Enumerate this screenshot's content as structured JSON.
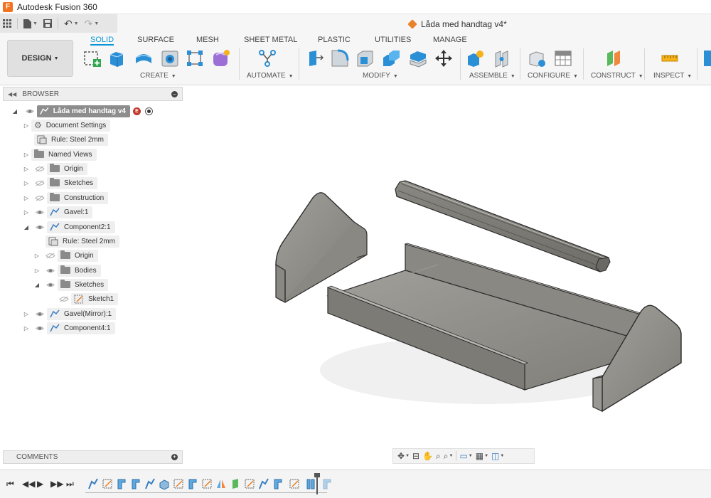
{
  "app": {
    "title": "Autodesk Fusion 360",
    "logo": "F"
  },
  "document": {
    "tab_title": "Låda med handtag v4*"
  },
  "ribbon": {
    "workspace": "DESIGN",
    "tabs": [
      "SOLID",
      "SURFACE",
      "MESH",
      "SHEET METAL",
      "PLASTIC",
      "UTILITIES",
      "MANAGE"
    ],
    "groups": [
      "CREATE",
      "AUTOMATE",
      "MODIFY",
      "ASSEMBLE",
      "CONFIGURE",
      "CONSTRUCT",
      "INSPECT"
    ]
  },
  "browser": {
    "title": "BROWSER",
    "root": {
      "label": "Låda med handtag v4"
    },
    "items": [
      {
        "label": "Document Settings",
        "icon": "gear-icon"
      },
      {
        "label": "Rule: Steel 2mm",
        "icon": "rule-icon"
      },
      {
        "label": "Named Views",
        "icon": "folder-icon"
      },
      {
        "label": "Origin",
        "icon": "folder-icon"
      },
      {
        "label": "Sketches",
        "icon": "folder-icon"
      },
      {
        "label": "Construction",
        "icon": "folder-icon"
      },
      {
        "label": "Gavel:1",
        "icon": "component-icon"
      },
      {
        "label": "Component2:1",
        "icon": "component-icon"
      },
      {
        "label": "Rule: Steel 2mm",
        "icon": "rule-icon"
      },
      {
        "label": "Origin",
        "icon": "folder-icon"
      },
      {
        "label": "Bodies",
        "icon": "folder-icon"
      },
      {
        "label": "Sketches",
        "icon": "folder-icon"
      },
      {
        "label": "Sketch1",
        "icon": "sketch-icon"
      },
      {
        "label": "Gavel(Mirror):1",
        "icon": "component-icon"
      },
      {
        "label": "Component4:1",
        "icon": "component-icon"
      }
    ]
  },
  "comments": {
    "title": "COMMENTS"
  },
  "colors": {
    "accent": "#0696d7",
    "model": "#8e8c86",
    "model_edge": "#2c2c2c"
  }
}
